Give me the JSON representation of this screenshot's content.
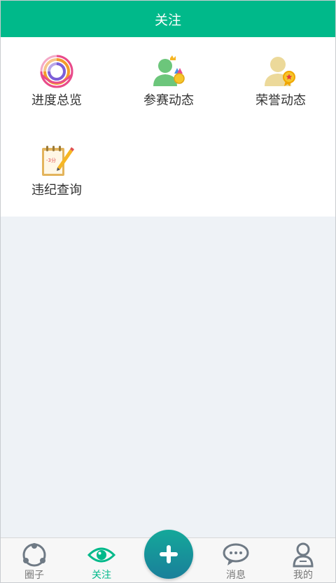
{
  "header": {
    "title": "关注"
  },
  "features": [
    {
      "label": "进度总览",
      "icon": "progress-rings-icon"
    },
    {
      "label": "参赛动态",
      "icon": "participant-medal-icon"
    },
    {
      "label": "荣誉动态",
      "icon": "honor-badge-icon"
    },
    {
      "label": "违纪查询",
      "icon": "violation-notepad-icon",
      "note_text": "-3分"
    }
  ],
  "tabbar": {
    "tabs": [
      {
        "label": "圈子",
        "icon": "circle-people-icon"
      },
      {
        "label": "关注",
        "icon": "eye-icon",
        "active": true
      },
      {
        "label": "",
        "icon": "plus-icon"
      },
      {
        "label": "消息",
        "icon": "chat-bubbles-icon"
      },
      {
        "label": "我的",
        "icon": "user-profile-icon"
      }
    ]
  },
  "colors": {
    "accent": "#00b98a",
    "background": "#eef2f6",
    "plus_button": "#1a8f9a"
  }
}
